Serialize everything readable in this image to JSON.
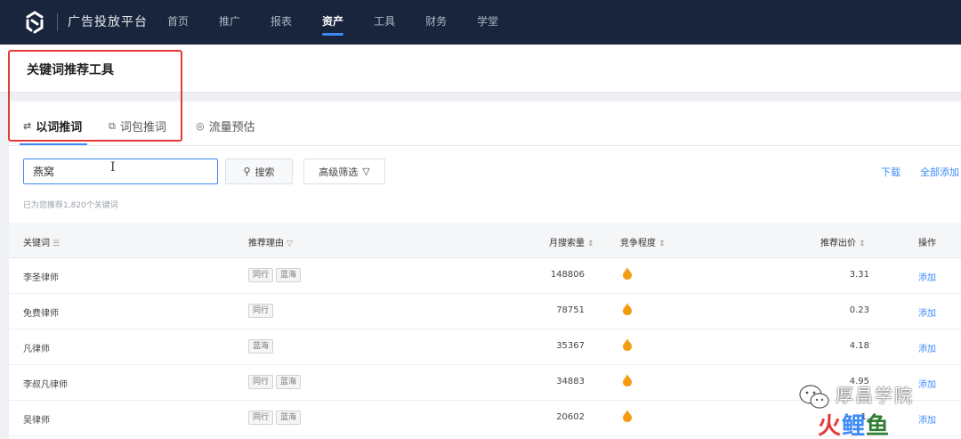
{
  "nav": {
    "brand": "广告投放平台",
    "items": [
      "首页",
      "推广",
      "报表",
      "资产",
      "工具",
      "财务",
      "学堂"
    ],
    "active_index": 3
  },
  "page": {
    "title": "关键词推荐工具"
  },
  "tabs": [
    {
      "label": "以词推词",
      "icon": "keyword-icon",
      "active": true
    },
    {
      "label": "词包推词",
      "icon": "package-icon",
      "active": false
    },
    {
      "label": "流量预估",
      "icon": "drop-icon",
      "active": false
    }
  ],
  "search": {
    "value": "燕窝",
    "button_label": "搜索",
    "filter_label": "高级筛选"
  },
  "actions": {
    "download": "下载",
    "add_all": "全部添加"
  },
  "hint": "已为您推荐1,820个关键词",
  "table": {
    "headers": {
      "keyword": "关键词",
      "reason": "推荐理由",
      "monthly_search": "月搜索量",
      "competition": "竞争程度",
      "bid": "推荐出价",
      "operation": "操作"
    },
    "rows": [
      {
        "keyword": "李圣律师",
        "tags": [
          "同行",
          "蓝海"
        ],
        "monthly_search": "148806",
        "bid": "3.31",
        "action": "添加"
      },
      {
        "keyword": "免费律师",
        "tags": [
          "同行"
        ],
        "monthly_search": "78751",
        "bid": "0.23",
        "action": "添加"
      },
      {
        "keyword": "凡律师",
        "tags": [
          "蓝海"
        ],
        "monthly_search": "35367",
        "bid": "4.18",
        "action": "添加"
      },
      {
        "keyword": "李叔凡律师",
        "tags": [
          "同行",
          "蓝海"
        ],
        "monthly_search": "34883",
        "bid": "4.95",
        "action": "添加"
      },
      {
        "keyword": "吴律师",
        "tags": [
          "同行",
          "蓝海"
        ],
        "monthly_search": "20602",
        "bid": "1.",
        "action": "添加"
      }
    ]
  },
  "watermark": {
    "line1": "厚昌学院",
    "line2": [
      "火",
      "鲤",
      "鱼"
    ]
  },
  "colors": {
    "nav_bg": "#18253c",
    "accent": "#3d8af7",
    "highlight": "#e53935",
    "flame": "#f39c12"
  }
}
